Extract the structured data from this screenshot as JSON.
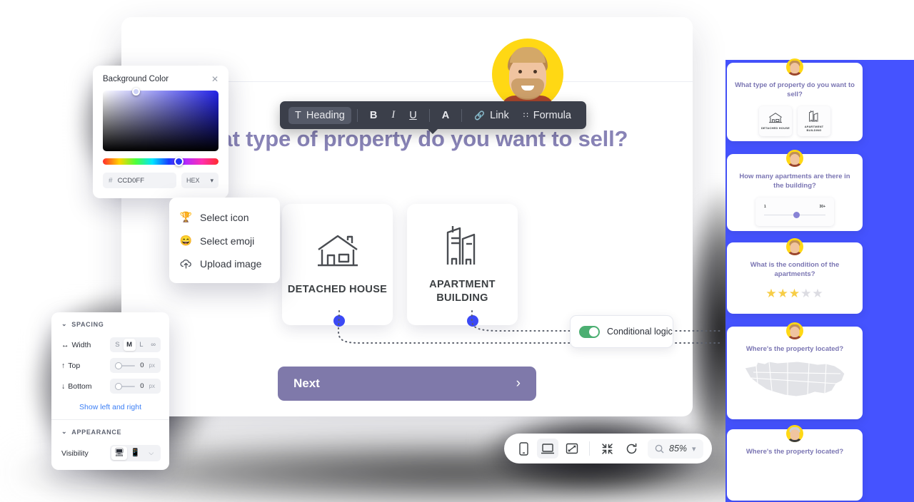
{
  "color_picker": {
    "title": "Background Color",
    "close_icon": "close-icon",
    "hex_value": "CCD0FF",
    "hash_symbol": "#",
    "mode_label": "HEX",
    "mode_chevron": "chevron-down-icon"
  },
  "format_toolbar": {
    "items": [
      {
        "label": "Heading",
        "icon": "text-style-icon",
        "active": true
      },
      {
        "label": "B",
        "icon": "bold-icon",
        "active": false
      },
      {
        "label": "I",
        "icon": "italic-icon",
        "active": false
      },
      {
        "label": "U",
        "icon": "underline-icon",
        "active": false
      },
      {
        "label": "A",
        "icon": "text-color-icon",
        "active": false
      },
      {
        "label": "Link",
        "icon": "link-icon",
        "active": false
      },
      {
        "label": "Formula",
        "icon": "formula-icon",
        "active": false
      }
    ]
  },
  "canvas": {
    "avatar_name": "respondent-avatar",
    "question_title": "What type of property do you want to sell?",
    "options": [
      {
        "label": "DETACHED HOUSE",
        "icon": "house-icon"
      },
      {
        "label": "APARTMENT BUILDING",
        "icon": "apartment-building-icon"
      }
    ],
    "next_button": {
      "label": "Next",
      "chevron": "chevron-right-icon"
    }
  },
  "context_menu": {
    "items": [
      {
        "label": "Select icon",
        "icon": "trophy-icon"
      },
      {
        "label": "Select emoji",
        "icon": "smiley-emoji-icon"
      },
      {
        "label": "Upload image",
        "icon": "cloud-upload-icon"
      }
    ]
  },
  "spacing_panel": {
    "sections": {
      "spacing_label": "SPACING",
      "appearance_label": "APPEARANCE"
    },
    "width": {
      "label": "Width",
      "icon": "horizontal-arrows-icon",
      "options": [
        "S",
        "M",
        "L",
        "∞"
      ],
      "selected": "M"
    },
    "top": {
      "label": "Top",
      "icon": "arrow-up-icon",
      "value": "0",
      "unit": "px"
    },
    "bottom": {
      "label": "Bottom",
      "icon": "arrow-down-icon",
      "value": "0",
      "unit": "px"
    },
    "show_left_right_link": "Show left and right",
    "visibility": {
      "label": "Visibility",
      "options": [
        "desktop-icon",
        "mobile-icon",
        "hidden-eye-icon"
      ],
      "selected": "desktop-icon"
    },
    "collapse_icon": "chevron-down-icon"
  },
  "conditional_logic": {
    "label": "Conditional logic",
    "enabled": true,
    "toggle_color": "#4caf72"
  },
  "bottom_toolbar": {
    "buttons": [
      {
        "name": "mobile-preview-icon",
        "active": false
      },
      {
        "name": "desktop-preview-icon",
        "active": true
      },
      {
        "name": "fullscreen-icon",
        "active": false
      },
      {
        "name": "collapse-icon",
        "active": false
      },
      {
        "name": "refresh-icon",
        "active": false
      }
    ],
    "zoom": {
      "search_icon": "magnifier-icon",
      "level": "85%",
      "chevron": "chevron-down-icon"
    }
  },
  "sidebar": {
    "cards": [
      {
        "title": "What type of property do you want to sell?",
        "type": "choices",
        "avatar": "man-avatar",
        "options": [
          {
            "label": "DETACHED HOUSE",
            "icon": "house-icon"
          },
          {
            "label": "APARTMENT BUILDING",
            "icon": "apartment-building-icon"
          }
        ]
      },
      {
        "title": "How many apartments are there in the building?",
        "type": "slider",
        "avatar": "man-avatar",
        "min_label": "1",
        "max_label": "30+"
      },
      {
        "title": "What is the condition of the apartments?",
        "type": "rating",
        "avatar": "man-avatar",
        "rating": 3,
        "rating_max": 5
      },
      {
        "title": "Where's the property located?",
        "type": "map",
        "avatar": "man-avatar",
        "map_icon": "usa-map-icon"
      },
      {
        "title": "Where's the property located?",
        "type": "map",
        "avatar": "woman-avatar"
      }
    ],
    "band_color": "#4553FF"
  }
}
